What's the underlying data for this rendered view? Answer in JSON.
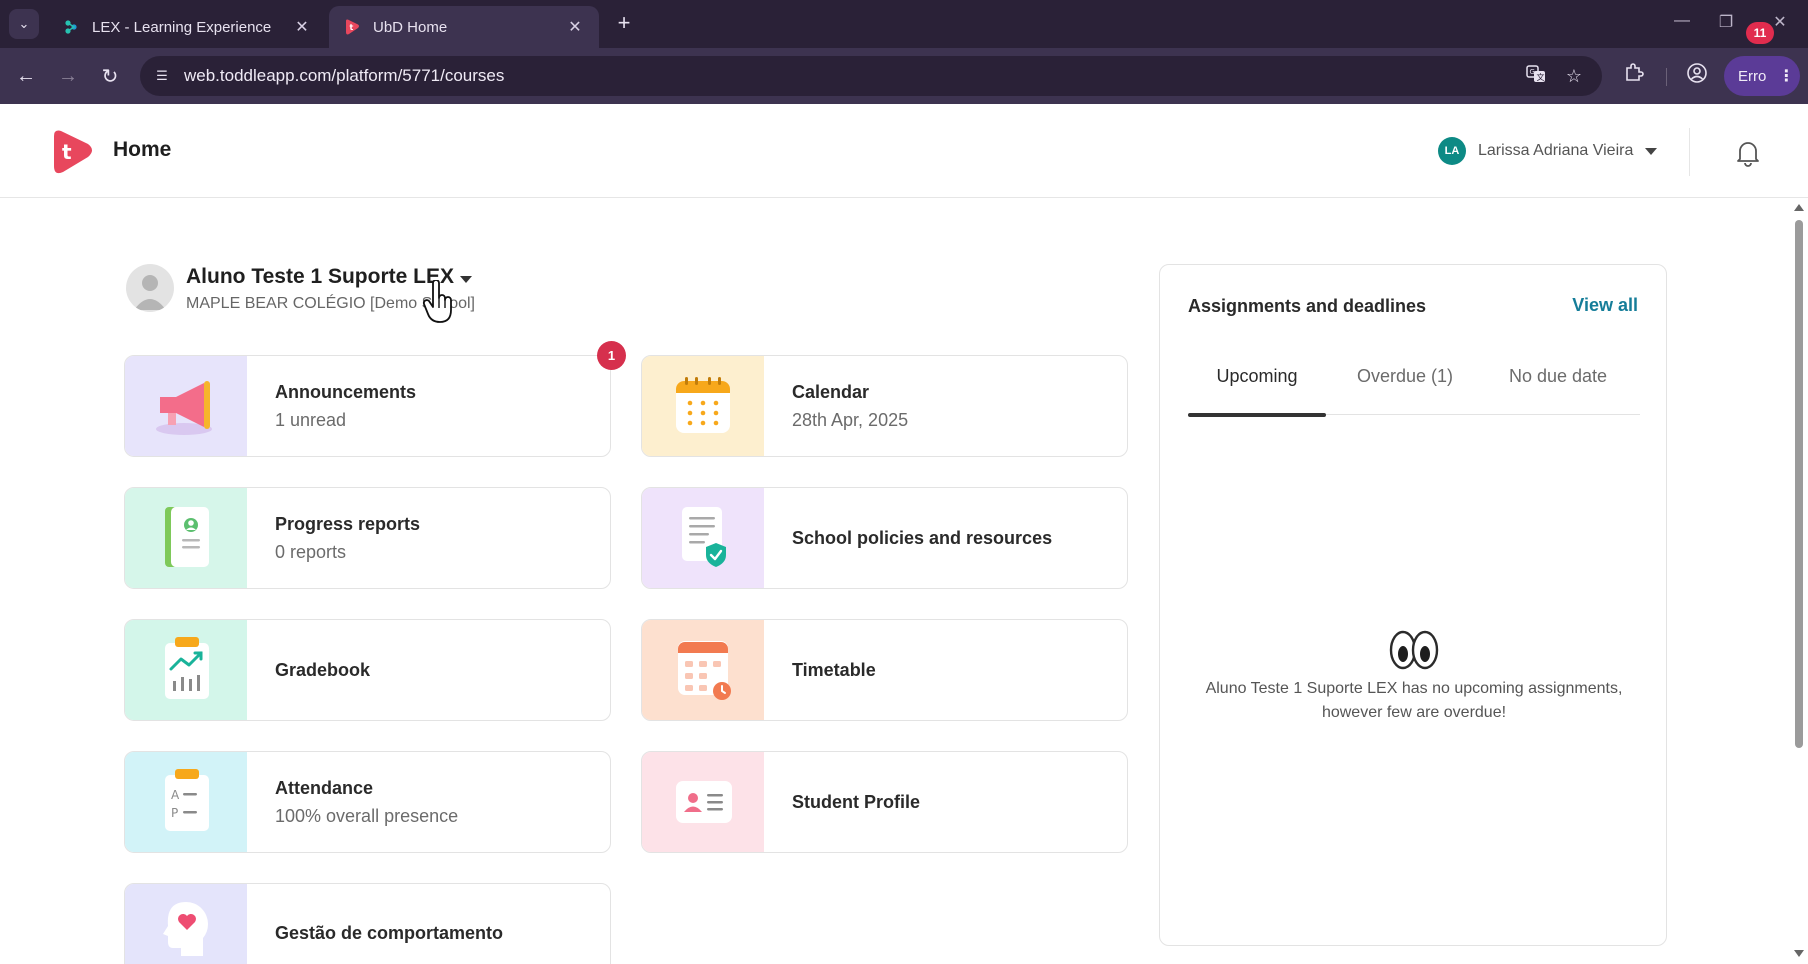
{
  "browser": {
    "tabs": [
      {
        "title": "LEX - Learning Experience",
        "active": false
      },
      {
        "title": "UbD Home",
        "active": true
      }
    ],
    "new_tab_icon": "plus-icon",
    "url": "web.toddleapp.com/platform/5771/courses",
    "profile_button_label": "Erro"
  },
  "header": {
    "title": "Home",
    "user": {
      "initials": "LA",
      "name": "Larissa Adriana Vieira"
    },
    "notifications_count": "11",
    "accent": "#e8475d"
  },
  "student": {
    "name": "Aluno Teste 1 Suporte LEX",
    "school": "MAPLE BEAR COLÉGIO [Demo School]"
  },
  "cards": [
    {
      "title": "Announcements",
      "subtitle": "1 unread",
      "badge": "1",
      "bg": "#e7e4fb",
      "icon": "megaphone-icon"
    },
    {
      "title": "Calendar",
      "subtitle": "28th Apr, 2025",
      "bg": "#fdefcf",
      "icon": "calendar-icon"
    },
    {
      "title": "Progress reports",
      "subtitle": "0 reports",
      "bg": "#d6f6ea",
      "icon": "report-book-icon"
    },
    {
      "title": "School policies and resources",
      "subtitle": "",
      "bg": "#efe3fb",
      "icon": "policy-document-icon"
    },
    {
      "title": "Gradebook",
      "subtitle": "",
      "bg": "#d3f6ea",
      "icon": "gradebook-chart-icon"
    },
    {
      "title": "Timetable",
      "subtitle": "",
      "bg": "#fde0cf",
      "icon": "timetable-icon"
    },
    {
      "title": "Attendance",
      "subtitle": "100% overall presence",
      "bg": "#d2f3f8",
      "icon": "attendance-clipboard-icon"
    },
    {
      "title": "Student Profile",
      "subtitle": "",
      "bg": "#fde2e8",
      "icon": "id-card-icon"
    },
    {
      "title": "Gestão de comportamento",
      "subtitle": "",
      "bg": "#e4e4fb",
      "icon": "behaviour-heart-icon"
    }
  ],
  "assignments": {
    "title": "Assignments and deadlines",
    "view_all": "View all",
    "tabs": [
      "Upcoming",
      "Overdue (1)",
      "No due date"
    ],
    "active_tab": "Upcoming",
    "empty_message": "Aluno Teste 1 Suporte LEX has no upcoming assignments, however few are overdue!"
  }
}
